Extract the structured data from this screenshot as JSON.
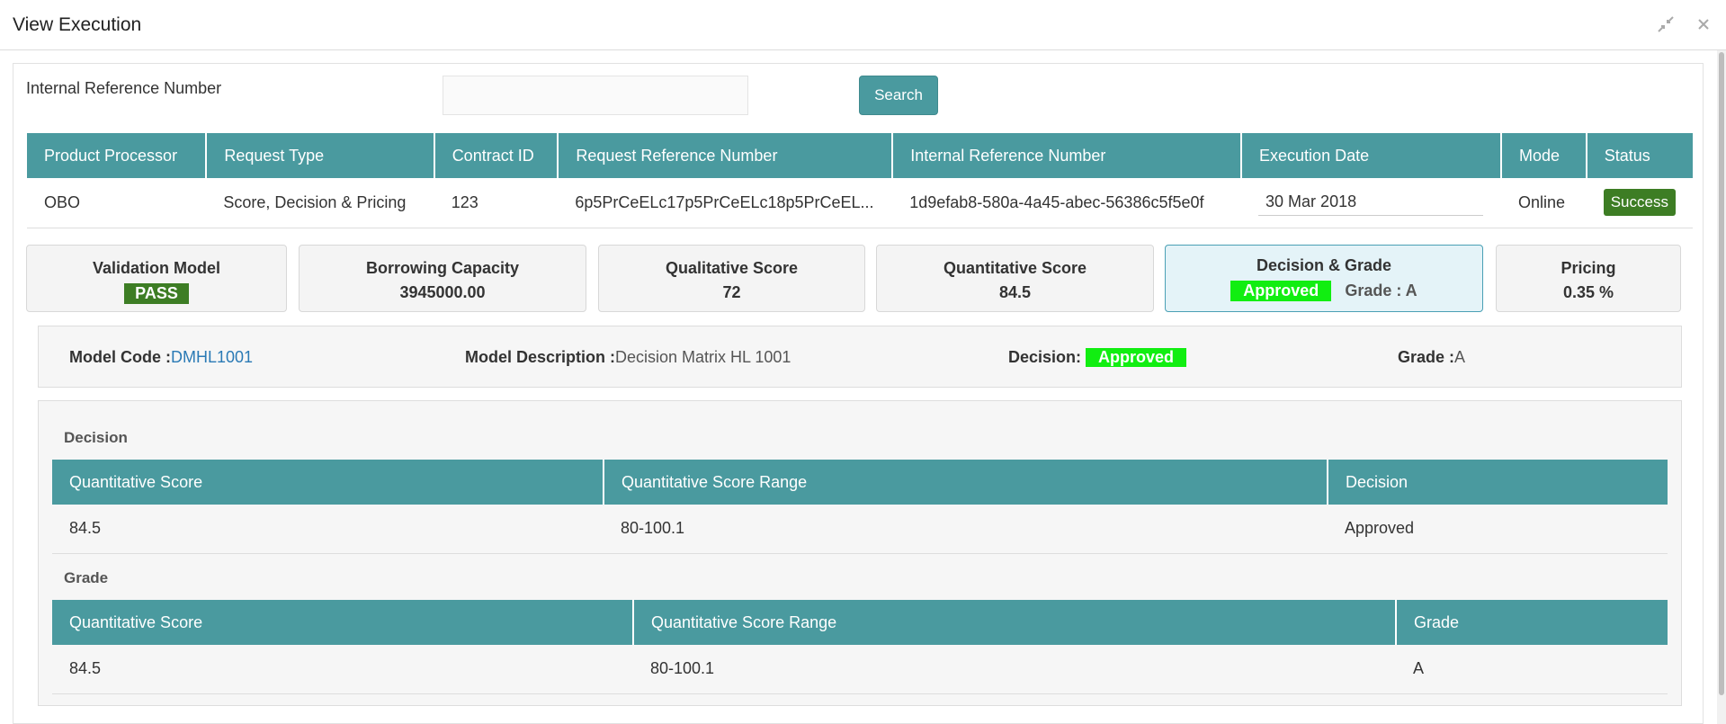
{
  "window": {
    "title": "View Execution",
    "minimize_icon": "compress-icon",
    "close_icon": "close-icon"
  },
  "search": {
    "label": "Internal Reference Number",
    "value": "",
    "placeholder": "",
    "button_label": "Search"
  },
  "main_table": {
    "headers": [
      "Product Processor",
      "Request Type",
      "Contract ID",
      "Request Reference Number",
      "Internal Reference Number",
      "Execution Date",
      "Mode",
      "Status"
    ],
    "row": {
      "product_processor": "OBO",
      "request_type": "Score, Decision & Pricing",
      "contract_id": "123",
      "request_reference_number": "6p5PrCeELc17p5PrCeELc18p5PrCeEL...",
      "internal_reference_number": "1d9efab8-580a-4a45-abec-56386c5f5e0f",
      "execution_date": "30 Mar 2018",
      "mode": "Online",
      "status": "Success"
    }
  },
  "cards": {
    "validation": {
      "title": "Validation Model",
      "value": "PASS"
    },
    "borrowing": {
      "title": "Borrowing Capacity",
      "value": "3945000.00"
    },
    "qualitative": {
      "title": "Qualitative Score",
      "value": "72"
    },
    "quantitative": {
      "title": "Quantitative Score",
      "value": "84.5"
    },
    "decision": {
      "title": "Decision & Grade",
      "decision": "Approved",
      "grade": "Grade : A"
    },
    "pricing": {
      "title": "Pricing",
      "value": "0.35 %"
    }
  },
  "model_info": {
    "code_label": "Model Code :",
    "code_value": "DMHL1001",
    "description_label": "Model Description :",
    "description_value": "Decision Matrix HL 1001",
    "decision_label": "Decision:",
    "decision_value": "Approved",
    "grade_label": "Grade :",
    "grade_value": "A"
  },
  "decision_section": {
    "title": "Decision",
    "headers": [
      "Quantitative Score",
      "Quantitative Score Range",
      "Decision"
    ],
    "row": [
      "84.5",
      "80-100.1",
      "Approved"
    ]
  },
  "grade_section": {
    "title": "Grade",
    "headers": [
      "Quantitative Score",
      "Quantitative Score Range",
      "Grade"
    ],
    "row": [
      "84.5",
      "80-100.1",
      "A"
    ]
  },
  "colors": {
    "teal_header": "#4a9a9f",
    "success_green": "#3d7d24",
    "approved_green": "#11ee11",
    "link_blue": "#2a7ab5"
  }
}
